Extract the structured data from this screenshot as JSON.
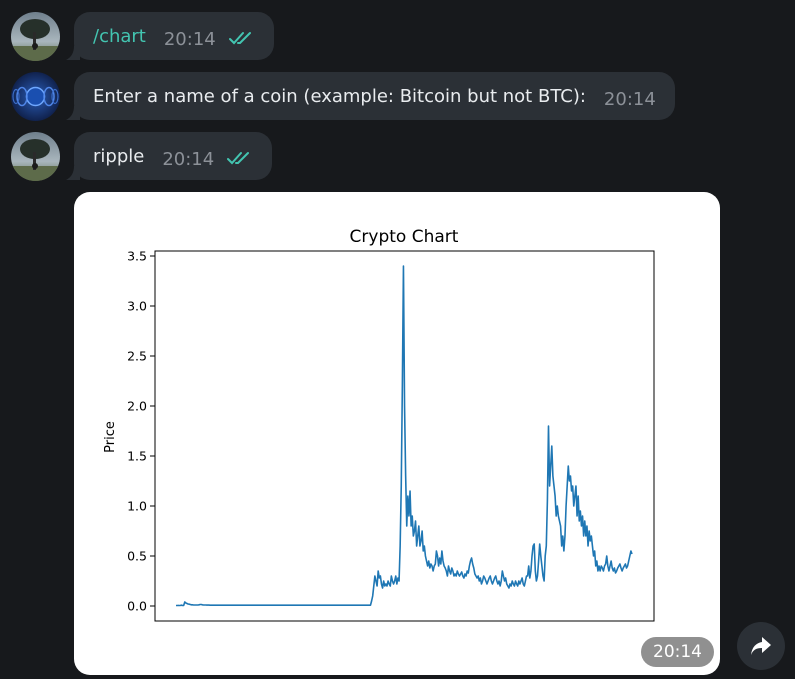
{
  "messages": [
    {
      "text": "/chart",
      "time": "20:14",
      "status": "read"
    },
    {
      "text": "Enter a name of a coin (example: Bitcoin but not BTC):",
      "time": "20:14"
    },
    {
      "text": "ripple",
      "time": "20:14",
      "status": "read"
    }
  ],
  "photo_message": {
    "time": "20:14"
  },
  "colors": {
    "accent": "#43c5b1",
    "bubble": "#2b3036",
    "background": "#17191c",
    "line": "#1f77b4"
  },
  "chart_data": {
    "type": "line",
    "title": "Crypto Chart",
    "xlabel": "",
    "ylabel": "Price",
    "ylim": [
      -0.15,
      3.55
    ],
    "yticks": [
      0.0,
      0.5,
      1.0,
      1.5,
      2.0,
      2.5,
      3.0,
      3.5
    ],
    "ytick_labels": [
      "0.0",
      "0.5",
      "1.0",
      "1.5",
      "2.0",
      "2.5",
      "3.0",
      "3.5"
    ],
    "grid": false,
    "series": [
      {
        "values": [
          0.005,
          0.005,
          0.006,
          0.005,
          0.006,
          0.008,
          0.005,
          0.006,
          0.04,
          0.03,
          0.025,
          0.02,
          0.018,
          0.015,
          0.012,
          0.012,
          0.01,
          0.01,
          0.01,
          0.01,
          0.01,
          0.012,
          0.015,
          0.015,
          0.012,
          0.01,
          0.01,
          0.01,
          0.009,
          0.009,
          0.009,
          0.008,
          0.008,
          0.008,
          0.008,
          0.008,
          0.008,
          0.008,
          0.008,
          0.008,
          0.008,
          0.008,
          0.008,
          0.008,
          0.008,
          0.008,
          0.008,
          0.008,
          0.008,
          0.008,
          0.008,
          0.008,
          0.008,
          0.008,
          0.008,
          0.008,
          0.008,
          0.008,
          0.008,
          0.008,
          0.008,
          0.008,
          0.008,
          0.008,
          0.008,
          0.008,
          0.008,
          0.008,
          0.008,
          0.008,
          0.008,
          0.008,
          0.008,
          0.008,
          0.008,
          0.008,
          0.008,
          0.008,
          0.008,
          0.008,
          0.008,
          0.008,
          0.008,
          0.008,
          0.008,
          0.008,
          0.008,
          0.008,
          0.008,
          0.008,
          0.008,
          0.008,
          0.008,
          0.008,
          0.008,
          0.008,
          0.008,
          0.008,
          0.008,
          0.008,
          0.008,
          0.008,
          0.008,
          0.008,
          0.008,
          0.008,
          0.008,
          0.008,
          0.008,
          0.008,
          0.008,
          0.008,
          0.008,
          0.008,
          0.008,
          0.008,
          0.008,
          0.008,
          0.008,
          0.008,
          0.008,
          0.008,
          0.008,
          0.008,
          0.008,
          0.008,
          0.008,
          0.008,
          0.008,
          0.008,
          0.008,
          0.008,
          0.008,
          0.008,
          0.008,
          0.008,
          0.008,
          0.008,
          0.008,
          0.008,
          0.008,
          0.008,
          0.008,
          0.008,
          0.008,
          0.008,
          0.008,
          0.008,
          0.008,
          0.008,
          0.008,
          0.008,
          0.008,
          0.008,
          0.008,
          0.008,
          0.008,
          0.008,
          0.008,
          0.008,
          0.008,
          0.008,
          0.008,
          0.008,
          0.008,
          0.008,
          0.008,
          0.008,
          0.008,
          0.008,
          0.008,
          0.008,
          0.008,
          0.008,
          0.008,
          0.008,
          0.008,
          0.008,
          0.05,
          0.1,
          0.2,
          0.3,
          0.25,
          0.2,
          0.35,
          0.28,
          0.3,
          0.22,
          0.18,
          0.25,
          0.2,
          0.22,
          0.2,
          0.25,
          0.22,
          0.2,
          0.3,
          0.25,
          0.22,
          0.25,
          0.3,
          0.22,
          0.28,
          0.25,
          0.6,
          1.2,
          2.2,
          3.4,
          2.0,
          1.3,
          0.8,
          1.1,
          0.9,
          1.15,
          0.8,
          0.9,
          0.7,
          0.75,
          0.85,
          0.6,
          0.7,
          0.8,
          0.6,
          0.65,
          0.75,
          0.55,
          0.6,
          0.5,
          0.45,
          0.4,
          0.45,
          0.38,
          0.42,
          0.4,
          0.35,
          0.4,
          0.42,
          0.55,
          0.5,
          0.4,
          0.48,
          0.42,
          0.55,
          0.45,
          0.4,
          0.38,
          0.35,
          0.3,
          0.4,
          0.35,
          0.32,
          0.38,
          0.35,
          0.3,
          0.32,
          0.3,
          0.35,
          0.32,
          0.3,
          0.32,
          0.34,
          0.3,
          0.28,
          0.32,
          0.3,
          0.35,
          0.33,
          0.4,
          0.45,
          0.48,
          0.42,
          0.38,
          0.32,
          0.3,
          0.28,
          0.3,
          0.25,
          0.28,
          0.22,
          0.25,
          0.3,
          0.28,
          0.25,
          0.22,
          0.25,
          0.28,
          0.3,
          0.25,
          0.22,
          0.25,
          0.28,
          0.3,
          0.25,
          0.22,
          0.25,
          0.2,
          0.25,
          0.35,
          0.3,
          0.25,
          0.28,
          0.22,
          0.2,
          0.18,
          0.22,
          0.2,
          0.25,
          0.22,
          0.2,
          0.25,
          0.22,
          0.2,
          0.25,
          0.22,
          0.25,
          0.28,
          0.22,
          0.2,
          0.25,
          0.3,
          0.3,
          0.4,
          0.28,
          0.35,
          0.5,
          0.6,
          0.62,
          0.35,
          0.25,
          0.3,
          0.45,
          0.62,
          0.5,
          0.4,
          0.3,
          0.25,
          0.5,
          0.6,
          1.05,
          1.8,
          1.2,
          1.4,
          1.6,
          1.3,
          1.2,
          1.1,
          0.9,
          1.0,
          0.9,
          0.85,
          0.8,
          0.6,
          0.7,
          0.55,
          0.7,
          1.0,
          1.2,
          1.4,
          1.25,
          1.3,
          1.15,
          1.2,
          1.0,
          1.1,
          1.2,
          0.9,
          1.1,
          0.85,
          0.95,
          0.8,
          0.9,
          0.7,
          0.85,
          0.7,
          0.8,
          0.6,
          0.75,
          0.65,
          0.7,
          0.6,
          0.5,
          0.55,
          0.4,
          0.45,
          0.35,
          0.4,
          0.35,
          0.4,
          0.38,
          0.35,
          0.4,
          0.42,
          0.5,
          0.4,
          0.35,
          0.4,
          0.45,
          0.38,
          0.35,
          0.38,
          0.33,
          0.35,
          0.38,
          0.4,
          0.42,
          0.38,
          0.35,
          0.38,
          0.4,
          0.42,
          0.38,
          0.4,
          0.45,
          0.5,
          0.55,
          0.52
        ]
      }
    ]
  }
}
